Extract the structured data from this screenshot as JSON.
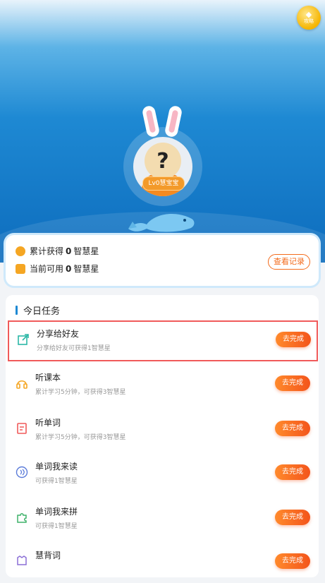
{
  "header": {
    "guide_label": "攻略"
  },
  "profile": {
    "level_badge": "Lv0慧宝宝",
    "avatar_symbol": "?"
  },
  "stats": {
    "total_label": "累计获得",
    "total_value": "0",
    "total_unit": "智慧星",
    "available_label": "当前可用",
    "available_value": "0",
    "available_unit": "智慧星",
    "record_button": "查看记录"
  },
  "tasks": {
    "title": "今日任务",
    "items": [
      {
        "name": "分享给好友",
        "desc": "分享给好友可获得1智慧星",
        "button": "去完成",
        "icon": "share-icon",
        "color": "#2bb7a6"
      },
      {
        "name": "听课本",
        "desc": "累计学习5分钟，可获得3智慧星",
        "button": "去完成",
        "icon": "headphones-icon",
        "color": "#f5a623"
      },
      {
        "name": "听单词",
        "desc": "累计学习5分钟，可获得3智慧星",
        "button": "去完成",
        "icon": "word-card-icon",
        "color": "#f05a5a"
      },
      {
        "name": "单词我来读",
        "desc": "可获得1智慧星",
        "button": "去完成",
        "icon": "voice-icon",
        "color": "#5b7bd9"
      },
      {
        "name": "单词我来拼",
        "desc": "可获得1智慧星",
        "button": "去完成",
        "icon": "puzzle-icon",
        "color": "#3fb26a"
      },
      {
        "name": "慧背词",
        "desc": "",
        "button": "去完成",
        "icon": "memory-icon",
        "color": "#8b6fd6"
      }
    ]
  },
  "colors": {
    "accent": "#f36b1c",
    "brand_blue": "#1e89d3"
  }
}
